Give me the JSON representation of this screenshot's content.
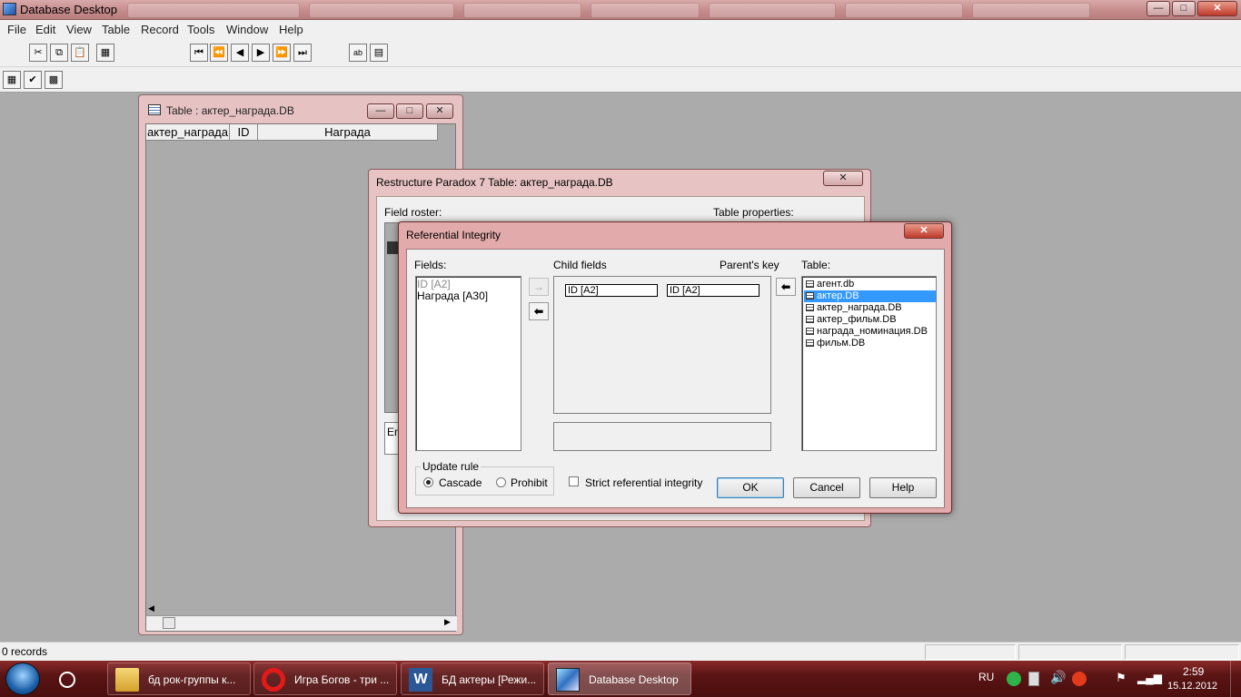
{
  "app": {
    "title": "Database Desktop"
  },
  "menu": [
    "File",
    "Edit",
    "View",
    "Table",
    "Record",
    "Tools",
    "Window",
    "Help"
  ],
  "title_buttons": {
    "min": "—",
    "max": "□",
    "close": "✕"
  },
  "table_window": {
    "title": "Table : актер_награда.DB",
    "columns": [
      "актер_награда",
      "ID",
      "Награда"
    ]
  },
  "restructure": {
    "title": "Restructure Paradox 7 Table: актер_награда.DB",
    "field_roster_label": "Field roster:",
    "table_properties_label": "Table properties:",
    "enter_partial": "En"
  },
  "ri": {
    "title": "Referential Integrity",
    "fields_label": "Fields:",
    "fields": [
      {
        "text": "ID [A2]",
        "disabled": true
      },
      {
        "text": "Награда [A30]",
        "disabled": false
      }
    ],
    "child_fields_label": "Child fields",
    "parents_key_label": "Parent's key",
    "child_value": "ID [A2]",
    "parent_value": "ID [A2]",
    "table_label": "Table:",
    "tables": [
      {
        "name": "агент.db",
        "selected": false
      },
      {
        "name": "актер.DB",
        "selected": true
      },
      {
        "name": "актер_награда.DB",
        "selected": false
      },
      {
        "name": "актер_фильм.DB",
        "selected": false
      },
      {
        "name": "награда_номинация.DB",
        "selected": false
      },
      {
        "name": "фильм.DB",
        "selected": false
      }
    ],
    "update_rule_label": "Update rule",
    "cascade_label": "Cascade",
    "prohibit_label": "Prohibit",
    "strict_label": "Strict referential integrity",
    "ok_label": "OK",
    "cancel_label": "Cancel",
    "help_label": "Help"
  },
  "status": {
    "records": "0 records"
  },
  "taskbar": {
    "tasks": [
      {
        "label": "бд рок-группы к...",
        "icon": "folder-icon",
        "active": false
      },
      {
        "label": "Игра Богов - три ...",
        "icon": "opera-icon",
        "active": false
      },
      {
        "label": "БД актеры [Режи...",
        "icon": "word-icon",
        "active": false
      },
      {
        "label": "Database Desktop",
        "icon": "database-desktop-icon",
        "active": true
      }
    ],
    "language": "RU",
    "time": "2:59",
    "date": "15.12.2012"
  }
}
